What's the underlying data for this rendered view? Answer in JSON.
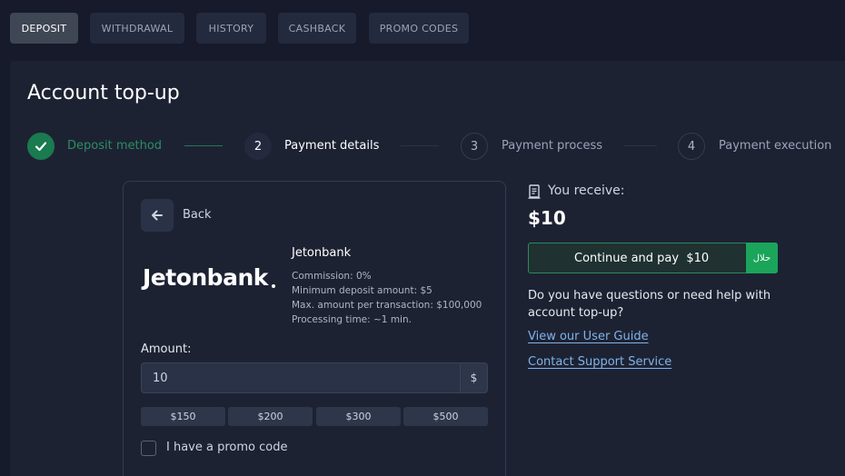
{
  "nav": {
    "tabs": [
      {
        "label": "DEPOSIT",
        "active": true
      },
      {
        "label": "WITHDRAWAL",
        "active": false
      },
      {
        "label": "HISTORY",
        "active": false
      },
      {
        "label": "CASHBACK",
        "active": false
      },
      {
        "label": "PROMO CODES",
        "active": false
      }
    ]
  },
  "page": {
    "title": "Account top-up"
  },
  "steps": [
    {
      "number": "1",
      "label": "Deposit method",
      "state": "done"
    },
    {
      "number": "2",
      "label": "Payment details",
      "state": "current"
    },
    {
      "number": "3",
      "label": "Payment process",
      "state": "pending"
    },
    {
      "number": "4",
      "label": "Payment execution",
      "state": "pending"
    }
  ],
  "form": {
    "back_label": "Back",
    "method": {
      "logo_text": "Jetonbank",
      "name": "Jetonbank",
      "commission": "Commission: 0%",
      "min_deposit": "Minimum deposit amount: $5",
      "max_amount": "Max. amount per transaction: $100,000",
      "processing_time": "Processing time: ~1 min."
    },
    "amount_label": "Amount:",
    "amount_value": "10",
    "currency": "$",
    "presets": [
      "$150",
      "$200",
      "$300",
      "$500"
    ],
    "promo_label": "I have a promo code",
    "promo_checked": false
  },
  "summary": {
    "receive_label": "You receive:",
    "receive_amount": "$10",
    "pay_button_label": "Continue and pay  $10",
    "halal_badge": "حلال",
    "help_text": "Do you have questions or need help with account top-up?",
    "guide_link": "View our User Guide",
    "support_link": "Contact Support Service"
  },
  "colors": {
    "background": "#161a2b",
    "panel": "#1d2233",
    "accent_green": "#1aa55a",
    "link": "#7fb3e8"
  }
}
